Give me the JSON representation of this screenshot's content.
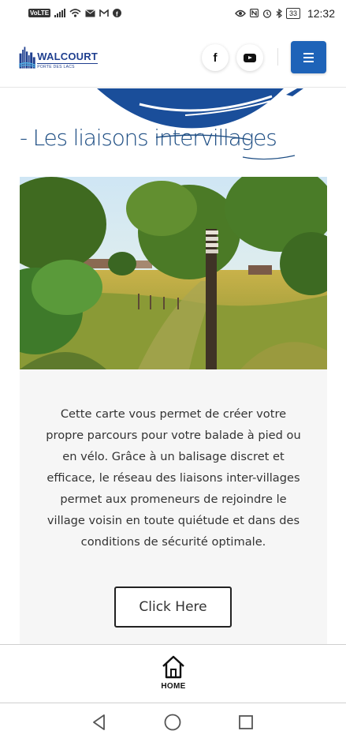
{
  "status_bar": {
    "left_icons": [
      "volte-icon",
      "signal-icon",
      "wifi-icon",
      "message-icon",
      "gmail-icon",
      "facebook-icon"
    ],
    "volte": "VoLTE",
    "right_icons": [
      "eye-icon",
      "nfc-icon",
      "alarm-icon",
      "bluetooth-icon",
      "battery-icon"
    ],
    "battery": "33",
    "time": "12:32"
  },
  "header": {
    "logo_name": "WALCOURT",
    "logo_tagline": "PORTE DES LACS",
    "social": [
      {
        "icon": "facebook-icon",
        "label": "f"
      },
      {
        "icon": "youtube-icon"
      }
    ],
    "menu_icon": "hamburger-menu-icon",
    "brand_color": "#1e63b8",
    "logo_color": "#1f3f8f"
  },
  "main": {
    "title": "- Les liaisons intervillages",
    "title_color": "#1d4d83",
    "photo_subject": "signpost-in-field",
    "body": "Cette carte vous permet de créer votre propre parcours pour votre balade à pied ou en vélo. Grâce à un balisage discret et efficace, le réseau des liaisons inter-villages permet aux promeneurs de rejoindre le village voisin en toute quiétude et dans des conditions de sécurité optimale.",
    "cta_label": "Click Here"
  },
  "bottom_bar": {
    "home_icon": "home-icon",
    "home_label": "HOME"
  },
  "android_nav": {
    "buttons": [
      "back-icon",
      "home-circle-icon",
      "recents-icon"
    ]
  }
}
